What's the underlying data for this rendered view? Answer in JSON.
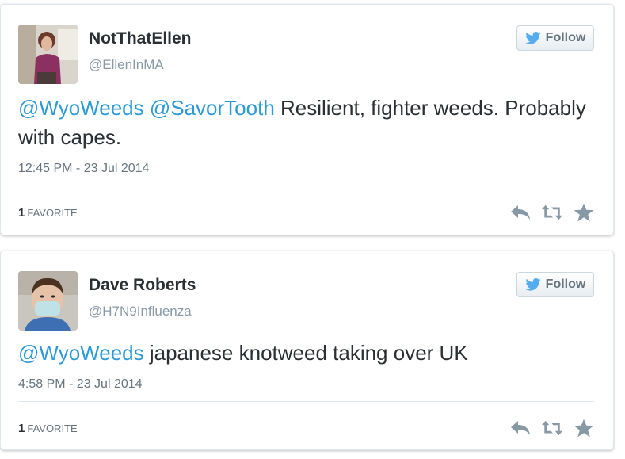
{
  "tweets": [
    {
      "name": "NotThatEllen",
      "handle": "@EllenInMA",
      "follow_label": "Follow",
      "mention1": "@WyoWeeds",
      "mention2": "@SavorTooth",
      "text": " Resilient, fighter weeds. Probably with capes.",
      "date": "12:45 PM - 23 Jul 2014",
      "fav_count": "1",
      "fav_label": "FAVORITE"
    },
    {
      "name": "Dave Roberts",
      "handle": "@H7N9Influenza",
      "follow_label": "Follow",
      "mention1": "@WyoWeeds",
      "text": " japanese knotweed taking over UK",
      "date": "4:58 PM - 23 Jul 2014",
      "fav_count": "1",
      "fav_label": "FAVORITE"
    }
  ],
  "colors": {
    "mention": "#2b9ad8",
    "twitter_bird": "#55acee",
    "icon": "#8899a6"
  },
  "icons": [
    "twitter-bird-icon",
    "reply-icon",
    "retweet-icon",
    "favorite-star-icon"
  ]
}
